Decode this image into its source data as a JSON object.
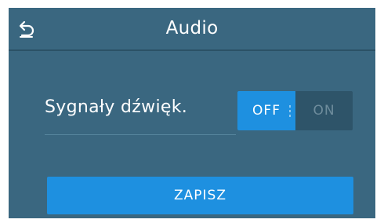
{
  "header": {
    "title": "Audio",
    "back_icon": "back-arrow-icon"
  },
  "settings": {
    "sound_signals": {
      "label": "Sygnały dźwięk.",
      "toggle": {
        "off_label": "OFF",
        "on_label": "ON",
        "selected": "OFF"
      }
    }
  },
  "footer": {
    "save_label": "ZAPISZ"
  },
  "colors": {
    "background": "#3a6780",
    "accent": "#1e90e0",
    "toggle_track": "#2e5469",
    "text": "#ffffff",
    "inactive_text": "#6e8c9c"
  }
}
